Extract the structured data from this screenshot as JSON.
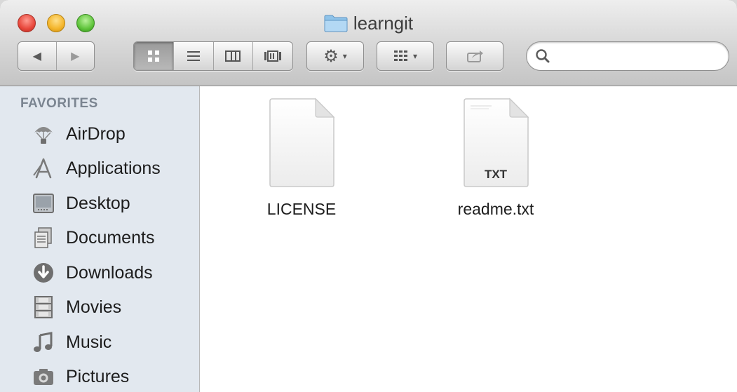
{
  "window": {
    "title": "learngit"
  },
  "toolbar": {
    "back_glyph": "◀",
    "forward_glyph": "▶",
    "view_modes": [
      "icon-view",
      "list-view",
      "column-view",
      "coverflow-view"
    ],
    "active_view": "icon-view",
    "action_caret": "▾",
    "arrange_caret": "▾",
    "search": {
      "value": "",
      "placeholder": ""
    }
  },
  "sidebar": {
    "section_title": "FAVORITES",
    "items": [
      {
        "label": "AirDrop",
        "icon": "airdrop-icon"
      },
      {
        "label": "Applications",
        "icon": "applications-icon"
      },
      {
        "label": "Desktop",
        "icon": "desktop-icon"
      },
      {
        "label": "Documents",
        "icon": "documents-icon"
      },
      {
        "label": "Downloads",
        "icon": "downloads-icon"
      },
      {
        "label": "Movies",
        "icon": "movies-icon"
      },
      {
        "label": "Music",
        "icon": "music-icon"
      },
      {
        "label": "Pictures",
        "icon": "pictures-icon"
      }
    ]
  },
  "files": [
    {
      "name": "LICENSE",
      "badge": ""
    },
    {
      "name": "readme.txt",
      "badge": "TXT"
    }
  ],
  "colors": {
    "sidebar_bg": "#e2e8ef",
    "section_title": "#7b8591",
    "close": "#e8473b",
    "minimize": "#f4b52a",
    "zoom": "#5fc43b"
  }
}
